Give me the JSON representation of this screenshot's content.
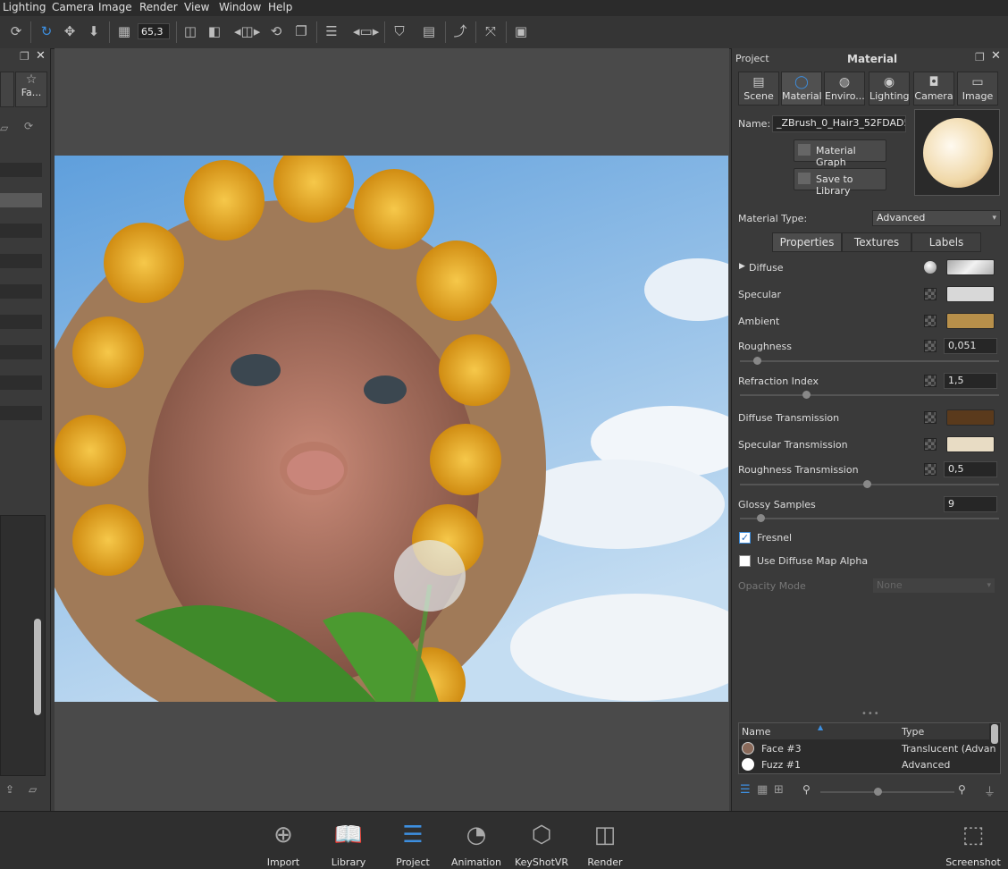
{
  "menu": [
    "Lighting",
    "Camera",
    "Image",
    "Render",
    "View",
    "Window",
    "Help"
  ],
  "toolbar": {
    "zoom_value": "65,3"
  },
  "panel": {
    "project_label": "Project",
    "section_title": "Material",
    "tabs": [
      {
        "label": "Scene",
        "icon": "scene-icon"
      },
      {
        "label": "Material",
        "icon": "material-icon"
      },
      {
        "label": "Enviro...",
        "icon": "environment-icon"
      },
      {
        "label": "Lighting",
        "icon": "lighting-icon"
      },
      {
        "label": "Camera",
        "icon": "camera-icon"
      },
      {
        "label": "Image",
        "icon": "image-icon"
      }
    ],
    "name_label": "Name:",
    "name_value": "_ZBrush_0_Hair3_52FDAD56",
    "material_graph_button": "Material Graph",
    "save_library_button": "Save to Library",
    "material_type_label": "Material Type:",
    "material_type_value": "Advanced",
    "subtabs": [
      "Properties",
      "Textures",
      "Labels"
    ],
    "properties": {
      "diffuse": "Diffuse",
      "specular": "Specular",
      "ambient": "Ambient",
      "roughness": "Roughness",
      "roughness_value": "0,051",
      "refraction_index": "Refraction Index",
      "refraction_value": "1,5",
      "diffuse_transmission": "Diffuse Transmission",
      "specular_transmission": "Specular Transmission",
      "roughness_transmission": "Roughness Transmission",
      "roughness_transmission_value": "0,5",
      "glossy_samples": "Glossy Samples",
      "glossy_samples_value": "9",
      "fresnel": "Fresnel",
      "use_diffuse_map_alpha": "Use Diffuse Map Alpha",
      "opacity_mode": "Opacity Mode",
      "opacity_mode_value": "None"
    },
    "colors": {
      "specular": "#d8d8d8",
      "ambient": "#b8904a",
      "diffuse_transmission": "#5a3a1c",
      "specular_transmission": "#e8dcc4"
    },
    "list": {
      "headers": [
        "Name",
        "Type"
      ],
      "rows": [
        {
          "name": "Face #3",
          "type": "Translucent (Advan"
        },
        {
          "name": "Fuzz #1",
          "type": "Advanced"
        }
      ]
    }
  },
  "dock": [
    {
      "label": "Import",
      "icon": "import-icon"
    },
    {
      "label": "Library",
      "icon": "library-icon"
    },
    {
      "label": "Project",
      "icon": "project-icon"
    },
    {
      "label": "Animation",
      "icon": "animation-icon"
    },
    {
      "label": "KeyShotVR",
      "icon": "keyshotvr-icon"
    },
    {
      "label": "Render",
      "icon": "render-icon"
    }
  ],
  "screenshot_label": "Screenshot"
}
